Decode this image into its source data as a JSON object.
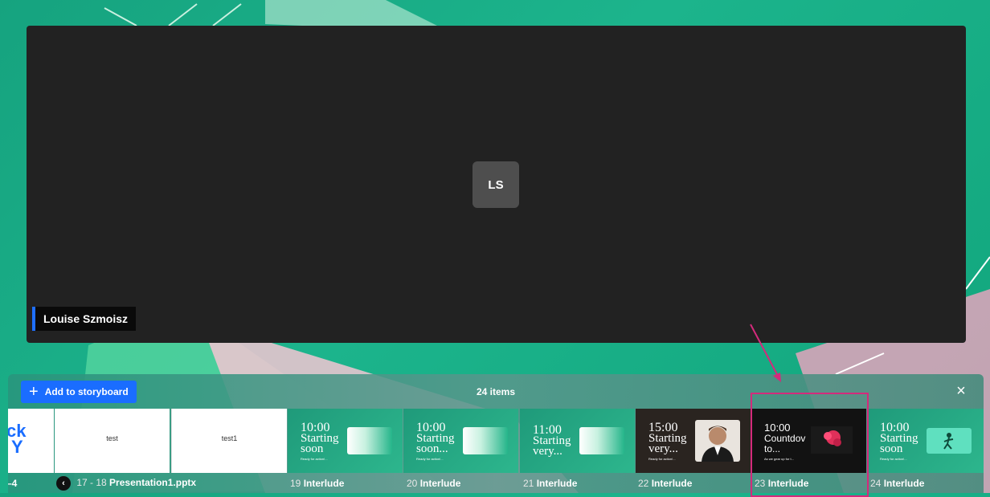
{
  "stage": {
    "avatar_initials": "LS",
    "participant_name": "Louise Szmoisz"
  },
  "tray": {
    "add_button_label": "Add to storyboard",
    "items_count": "24 items",
    "close_icon": "×"
  },
  "thumbnails": [
    {
      "kind": "logo",
      "text1": "ck",
      "text2": "Y"
    },
    {
      "kind": "text",
      "text": "test"
    },
    {
      "kind": "text",
      "text": "test1"
    },
    {
      "kind": "interlude",
      "time": "10:00",
      "title": "Starting",
      "title2": "soon",
      "sub": "Ready for action!..."
    },
    {
      "kind": "interlude",
      "time": "10:00",
      "title": "Starting",
      "title2": "soon...",
      "sub": "Ready for action!..."
    },
    {
      "kind": "interlude",
      "time": "11:00",
      "title": "Starting",
      "title2": "very...",
      "sub": ""
    },
    {
      "kind": "interlude",
      "time": "15:00",
      "title": "Starting",
      "title2": "very...",
      "sub": "Ready for action!..."
    },
    {
      "kind": "countdown",
      "time": "10:00",
      "title": "Countdov",
      "title2": "to...",
      "sub": "As we gear up for t..."
    },
    {
      "kind": "interlude",
      "time": "10:00",
      "title": "Starting",
      "title2": "soon",
      "sub": "Ready for action!..."
    }
  ],
  "labels": [
    {
      "num": "",
      "name": "–4"
    },
    {
      "num": "17 - 18",
      "name": "Presentation1.pptx"
    },
    {
      "num": "19",
      "name": "Interlude"
    },
    {
      "num": "20",
      "name": "Interlude"
    },
    {
      "num": "21",
      "name": "Interlude"
    },
    {
      "num": "22",
      "name": "Interlude"
    },
    {
      "num": "23",
      "name": "Interlude"
    },
    {
      "num": "24",
      "name": "Interlude"
    }
  ],
  "colors": {
    "accent_blue": "#1a6dff",
    "highlight_pink": "#d42a7c",
    "stage_bg": "#222222"
  }
}
